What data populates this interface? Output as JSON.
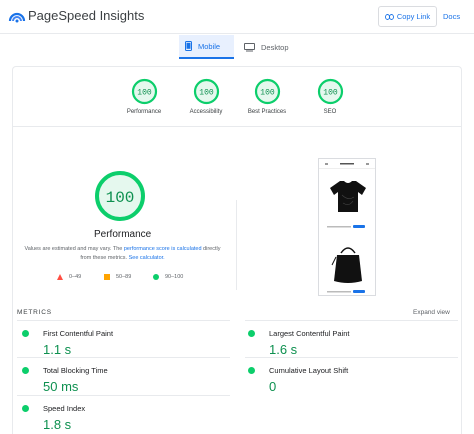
{
  "header": {
    "app_title": "PageSpeed Insights",
    "copy_link": "Copy Link",
    "docs": "Docs"
  },
  "tabs": [
    {
      "label": "Mobile",
      "active": true,
      "icon": "phone-icon"
    },
    {
      "label": "Desktop",
      "active": false,
      "icon": "desktop-icon"
    }
  ],
  "scores": [
    {
      "label": "Performance",
      "score": "100"
    },
    {
      "label": "Accessibility",
      "score": "100"
    },
    {
      "label": "Best Practices",
      "score": "100"
    },
    {
      "label": "SEO",
      "score": "100"
    }
  ],
  "performance": {
    "score": "100",
    "title": "Performance",
    "note_prefix": "Values are estimated and may vary. The ",
    "note_link1": "performance score is calculated",
    "note_middle": " directly from these metrics. ",
    "note_link2": "See calculator."
  },
  "legend": [
    {
      "range": "0–49",
      "color": "#ff4e42",
      "shape": "triangle"
    },
    {
      "range": "50–89",
      "color": "#ffa400",
      "shape": "square"
    },
    {
      "range": "90–100",
      "color": "#0cce6b",
      "shape": "circle"
    }
  ],
  "metrics": {
    "title": "METRICS",
    "expand": "Expand view",
    "items": [
      {
        "label": "First Contentful Paint",
        "value": "1.1 s"
      },
      {
        "label": "Largest Contentful Paint",
        "value": "1.6 s"
      },
      {
        "label": "Total Blocking Time",
        "value": "50 ms"
      },
      {
        "label": "Cumulative Layout Shift",
        "value": "0"
      },
      {
        "label": "Speed Index",
        "value": "1.8 s"
      }
    ]
  },
  "colors": {
    "accent": "#1a73e8",
    "pass": "#0cce6b",
    "pass_text": "#0d904f",
    "gauge_fill": "#e5f8ee"
  }
}
